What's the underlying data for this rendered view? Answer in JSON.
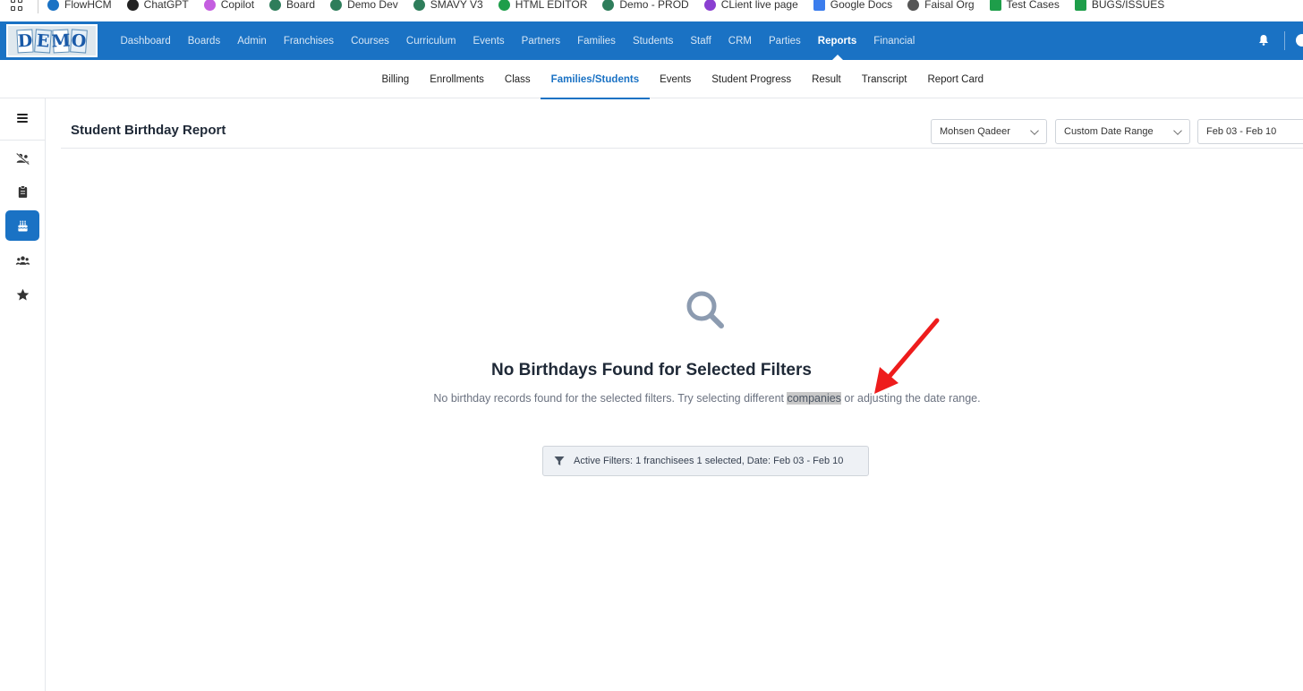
{
  "bookmarks": [
    {
      "label": "FlowHCM",
      "color": "#1a72c4"
    },
    {
      "label": "ChatGPT",
      "color": "#222222"
    },
    {
      "label": "Copilot",
      "color": "#c45ee0"
    },
    {
      "label": "Board",
      "color": "#2e7d5b"
    },
    {
      "label": "Demo Dev",
      "color": "#2e7d5b"
    },
    {
      "label": "SMAVY V3",
      "color": "#2e7d5b"
    },
    {
      "label": "HTML EDITOR",
      "color": "#1e9e4a"
    },
    {
      "label": "Demo - PROD",
      "color": "#2e7d5b"
    },
    {
      "label": "CLient live page",
      "color": "#8a3fd1"
    },
    {
      "label": "Google Docs",
      "color": "#3b7ded"
    },
    {
      "label": "Faisal Org",
      "color": "#555555"
    },
    {
      "label": "Test Cases",
      "color": "#1e9e4a"
    },
    {
      "label": "BUGS/ISSUES",
      "color": "#1e9e4a"
    }
  ],
  "logo_letters": [
    "D",
    "E",
    "M",
    "O"
  ],
  "nav": {
    "items": [
      "Dashboard",
      "Boards",
      "Admin",
      "Franchises",
      "Courses",
      "Curriculum",
      "Events",
      "Partners",
      "Families",
      "Students",
      "Staff",
      "CRM",
      "Parties",
      "Reports",
      "Financial"
    ],
    "active": "Reports"
  },
  "subtabs": {
    "items": [
      "Billing",
      "Enrollments",
      "Class",
      "Families/Students",
      "Events",
      "Student Progress",
      "Result",
      "Transcript",
      "Report Card"
    ],
    "active": "Families/Students"
  },
  "sidebar": {
    "icons": [
      "users-slash-icon",
      "clipboard-icon",
      "birthday-cake-icon",
      "users-icon",
      "star-icon"
    ],
    "active_index": 2
  },
  "page": {
    "title": "Student Birthday Report",
    "franchise_select": "Mohsen Qadeer",
    "date_range_select": "Custom Date Range",
    "date_range_value": "Feb 03 - Feb 10"
  },
  "empty_state": {
    "title": "No Birthdays Found for Selected Filters",
    "desc_before": "No birthday records found for the selected filters. Try selecting different ",
    "desc_highlight": "companies",
    "desc_after": " or adjusting the date range.",
    "active_filters": "Active Filters: 1 franchisees 1 selected, Date: Feb 03 - Feb 10"
  },
  "colors": {
    "primary": "#1a72c4",
    "annotation_arrow": "#ee1c1c"
  }
}
